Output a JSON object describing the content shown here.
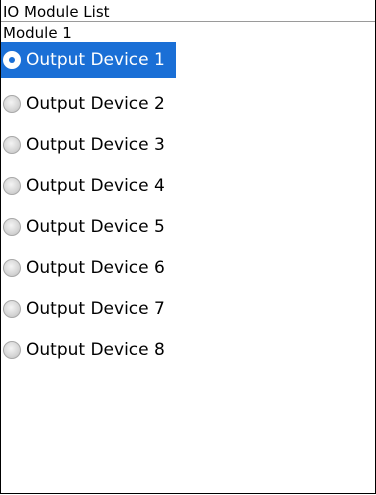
{
  "screen": {
    "title": "IO Module List",
    "group_label": "Module 1"
  },
  "devices": [
    {
      "label": "Output Device 1",
      "selected": true
    },
    {
      "label": "Output Device 2",
      "selected": false
    },
    {
      "label": "Output Device 3",
      "selected": false
    },
    {
      "label": "Output Device 4",
      "selected": false
    },
    {
      "label": "Output Device 5",
      "selected": false
    },
    {
      "label": "Output Device 6",
      "selected": false
    },
    {
      "label": "Output Device 7",
      "selected": false
    },
    {
      "label": "Output Device 8",
      "selected": false
    }
  ],
  "colors": {
    "selection": "#1a6fd6"
  }
}
